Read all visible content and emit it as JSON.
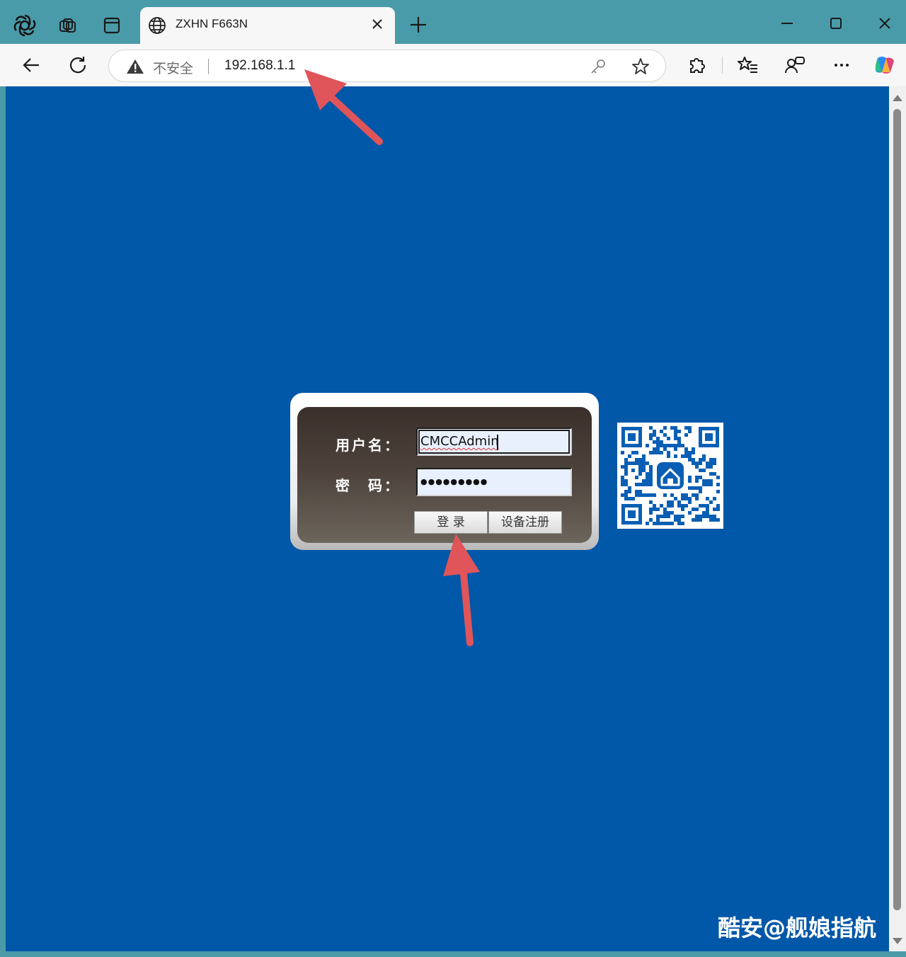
{
  "browser": {
    "tab": {
      "title": "ZXHN F663N"
    },
    "address_bar": {
      "security_label": "不安全",
      "url": "192.168.1.1"
    }
  },
  "login_form": {
    "username_label": "用户名：",
    "password_label": "密　码：",
    "username_value": "CMCCAdmin",
    "password_mask": "●●●●●●●●●",
    "login_button": "登 录",
    "register_button": "设备注册"
  },
  "watermark": "酷安@舰娘指航",
  "colors": {
    "page_background": "#0157a8",
    "annotation_arrow": "#e0555a",
    "qr_code": "#0a5fb4"
  }
}
